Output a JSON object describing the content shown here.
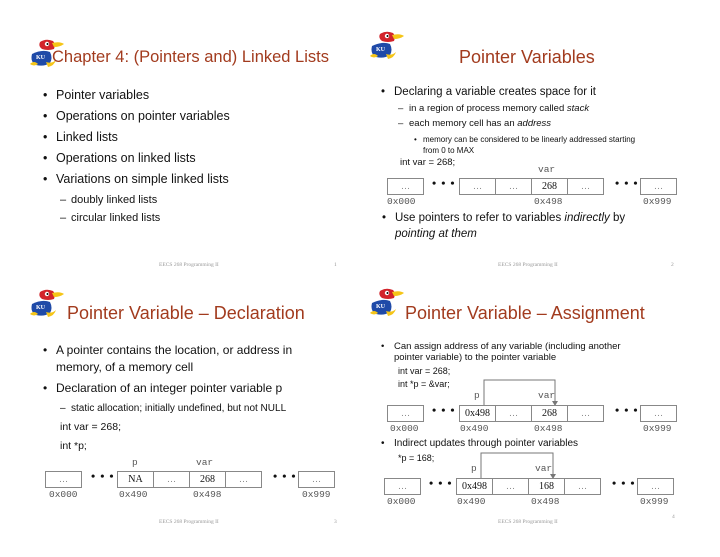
{
  "footer_text": "EECS 268 Programming II",
  "colors": {
    "title": "#a23b1e",
    "logo_blue": "#1f4aa8",
    "logo_red": "#d2232a",
    "logo_yellow": "#f5c518"
  },
  "slides": [
    {
      "number": "1",
      "title": "Chapter 4: (Pointers and) Linked Lists",
      "bullets": [
        "Pointer variables",
        "Operations on pointer variables",
        "Linked lists",
        "Operations on linked lists",
        "Variations on simple linked lists"
      ],
      "sub_bullets": [
        "doubly  linked lists",
        "circular linked lists"
      ]
    },
    {
      "number": "2",
      "title": "Pointer Variables",
      "bullet1": "Declaring a variable creates space for it",
      "sub1_prefix": "in a region of process memory called ",
      "sub1_em": "stack",
      "sub2_prefix": "each memory cell has an ",
      "sub2_em": "address",
      "sub3_line1": "memory can be considered to be linearly addressed starting",
      "sub3_line2": "from 0 to MAX",
      "code": "int var = 268;",
      "memory": {
        "var_label": "var",
        "cells": [
          "…",
          "…",
          "…",
          "268",
          "…",
          "…"
        ],
        "ellipsis": "• • •",
        "addresses": [
          "0x000",
          "0x498",
          "0x999"
        ]
      },
      "bullet2_prefix": "Use pointers to refer to variables ",
      "bullet2_em1": "indirectly",
      "bullet2_mid": " by",
      "bullet2_em2": "pointing at them"
    },
    {
      "number": "3",
      "title": "Pointer Variable – Declaration",
      "bullet1_line1": "A pointer contains the location, or address in",
      "bullet1_line2": "memory, of a memory cell",
      "bullet2": "Declaration of an integer pointer variable p",
      "sub1": "static allocation; initially undefined, but not NULL",
      "code1": "int var = 268;",
      "code2": "int *p;",
      "memory": {
        "p_label": "p",
        "var_label": "var",
        "cells": [
          "…",
          "NA",
          "…",
          "268",
          "…",
          "…"
        ],
        "ellipsis": "• • •",
        "addresses": [
          "0x000",
          "0x490",
          "0x498",
          "0x999"
        ]
      }
    },
    {
      "number": "4",
      "title": "Pointer Variable – Assignment",
      "bullet1_line1": "Can assign address of any variable (including another",
      "bullet1_line2": "pointer variable) to the pointer variable",
      "code1": "int var = 268;",
      "code2": "int *p  = &var;",
      "memory1": {
        "p_label": "p",
        "var_label": "var",
        "cells": [
          "…",
          "0x498",
          "…",
          "268",
          "…",
          "…"
        ],
        "ellipsis": "• • •",
        "addresses": [
          "0x000",
          "0x490",
          "0x498",
          "0x999"
        ]
      },
      "bullet2": "Indirect updates through pointer variables",
      "code3": "*p = 168;",
      "memory2": {
        "p_label": "p",
        "var_label": "var",
        "cells": [
          "…",
          "0x498",
          "…",
          "168",
          "…",
          "…"
        ],
        "ellipsis": "• • •",
        "addresses": [
          "0x000",
          "0x490",
          "0x498",
          "0x999"
        ]
      }
    }
  ]
}
